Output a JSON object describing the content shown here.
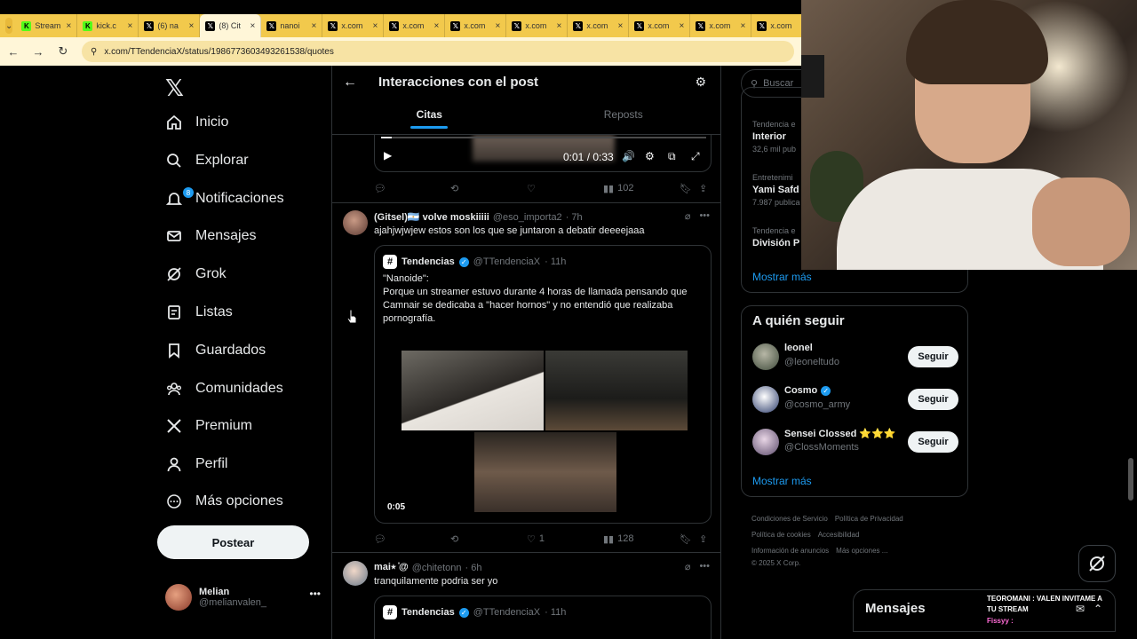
{
  "browser": {
    "tabs": [
      {
        "label": "Stream",
        "favicon": "kick-icon"
      },
      {
        "label": "kick.c",
        "favicon": "kick-icon"
      },
      {
        "label": "(6) na",
        "favicon": "x-icon"
      },
      {
        "label": "(8) Cit",
        "favicon": "x-icon",
        "active": true
      },
      {
        "label": "nanoi",
        "favicon": "x-icon"
      },
      {
        "label": "x.com",
        "favicon": "x-icon"
      },
      {
        "label": "x.com",
        "favicon": "x-icon"
      },
      {
        "label": "x.com",
        "favicon": "x-icon"
      },
      {
        "label": "x.com",
        "favicon": "x-icon"
      },
      {
        "label": "x.com",
        "favicon": "x-icon"
      },
      {
        "label": "x.com",
        "favicon": "x-icon"
      },
      {
        "label": "x.com",
        "favicon": "x-icon"
      },
      {
        "label": "x.com",
        "favicon": "x-icon"
      }
    ],
    "url": "x.com/TTendenciaX/status/1986773603493261538/quotes"
  },
  "nav": {
    "items": [
      {
        "label": "Inicio",
        "icon": "home-icon"
      },
      {
        "label": "Explorar",
        "icon": "search-icon"
      },
      {
        "label": "Notificaciones",
        "icon": "bell-icon",
        "badge": "8"
      },
      {
        "label": "Mensajes",
        "icon": "mail-icon"
      },
      {
        "label": "Grok",
        "icon": "grok-icon"
      },
      {
        "label": "Listas",
        "icon": "list-icon"
      },
      {
        "label": "Guardados",
        "icon": "bookmark-icon"
      },
      {
        "label": "Comunidades",
        "icon": "communities-icon"
      },
      {
        "label": "Premium",
        "icon": "x-icon"
      },
      {
        "label": "Perfil",
        "icon": "person-icon"
      },
      {
        "label": "Más opciones",
        "icon": "more-circle-icon"
      }
    ],
    "post_button": "Postear",
    "account": {
      "name": "Melian",
      "handle": "@melianvalen_"
    }
  },
  "main": {
    "title": "Interacciones con el post",
    "tabs": [
      {
        "label": "Citas",
        "active": true
      },
      {
        "label": "Reposts",
        "active": false
      }
    ],
    "video1": {
      "time": "0:01 / 0:33",
      "progress": 0.03
    },
    "post1_actions": {
      "views": "102"
    },
    "post2": {
      "name": "(Gitsel)🇦🇷 volve moskiiiii",
      "handle": "@eso_importa2",
      "time": "· 7h",
      "text": "ajahjwjwjew estos son los que se juntaron a debatir deeeejaaa",
      "quote": {
        "name": "Tendencias",
        "handle": "@TTendenciaX",
        "time": "· 11h",
        "text": "\"Nanoide\":\nPorque un streamer estuvo durante 4 horas de llamada pensando que Camnair se dedicaba a \"hacer hornos\" y no entendió que realizaba pornografía.",
        "duration": "0:05"
      },
      "likes": "1",
      "views": "128"
    },
    "post3": {
      "name": "mai⭑ ̊@",
      "handle": "@chitetonn",
      "time": "· 6h",
      "text": "tranquilamente podria ser yo",
      "quote": {
        "name": "Tendencias",
        "handle": "@TTendenciaX",
        "time": "· 11h"
      }
    }
  },
  "right": {
    "search_placeholder": "Buscar",
    "trends": [
      {
        "context": "Tendencia e",
        "title": "Interior",
        "posts": "32,6 mil pub"
      },
      {
        "context": "Entretenimi",
        "title": "Yami Safd",
        "posts": "7.987 publica"
      },
      {
        "context": "Tendencia e",
        "title": "División P",
        "posts": ""
      }
    ],
    "trends_more": "Mostrar más",
    "who_to_follow": {
      "title": "A quién seguir",
      "accounts": [
        {
          "name": "leonel",
          "handle": "@leoneltudo",
          "verified": false,
          "button": "Seguir"
        },
        {
          "name": "Cosmo",
          "handle": "@cosmo_army",
          "verified": true,
          "button": "Seguir"
        },
        {
          "name": "Sensei Clossed ⭐⭐⭐",
          "handle": "@ClossMoments",
          "verified": false,
          "button": "Seguir"
        }
      ],
      "more": "Mostrar más"
    },
    "footer": [
      "Condiciones de Servicio",
      "Política de Privacidad",
      "Política de cookies",
      "Accesibilidad",
      "Información de anuncios",
      "Más opciones ...",
      "© 2025 X Corp."
    ]
  },
  "messages": {
    "title": "Mensajes",
    "chat_overlay": "TEOROMANI : VALEN INVITAME A TU STREAM",
    "chat_overlay2": "Fissyy :"
  },
  "colors": {
    "accent": "#1d9bf0",
    "bg": "#000000",
    "chrome": "#f2c94c"
  }
}
